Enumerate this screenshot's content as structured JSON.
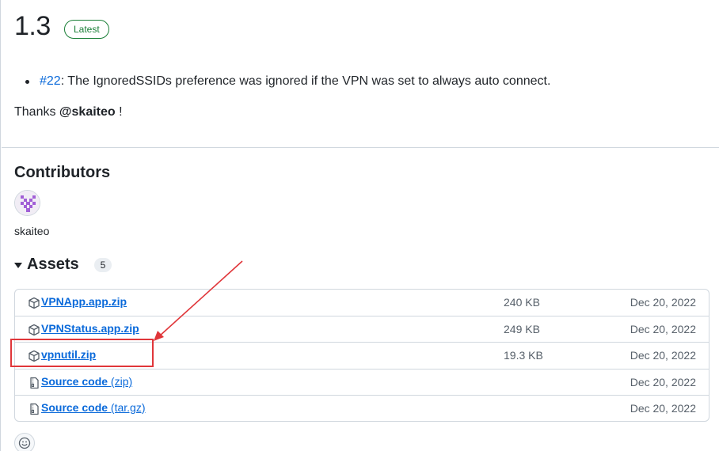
{
  "release": {
    "title": "1.3",
    "badge": "Latest"
  },
  "notes": {
    "issue_link": "#22",
    "issue_text": ": The IgnoredSSIDs preference was ignored if the VPN was set to always auto connect.",
    "thanks_prefix": "Thanks ",
    "thanks_user": "@skaiteo",
    "thanks_suffix": " !"
  },
  "contributors": {
    "heading": "Contributors",
    "users": [
      {
        "name": "skaiteo",
        "avatar_icon": "identicon"
      }
    ]
  },
  "assets": {
    "heading": "Assets",
    "count": "5",
    "items": [
      {
        "name": "VPNApp.app.zip",
        "ext": "",
        "size": "240 KB",
        "date": "Dec 20, 2022",
        "icon": "package-icon"
      },
      {
        "name": "VPNStatus.app.zip",
        "ext": "",
        "size": "249 KB",
        "date": "Dec 20, 2022",
        "icon": "package-icon"
      },
      {
        "name": "vpnutil.zip",
        "ext": "",
        "size": "19.3 KB",
        "date": "Dec 20, 2022",
        "icon": "package-icon"
      },
      {
        "name": "Source code",
        "ext": " (zip)",
        "size": "",
        "date": "Dec 20, 2022",
        "icon": "file-zip-icon"
      },
      {
        "name": "Source code",
        "ext": " (tar.gz)",
        "size": "",
        "date": "Dec 20, 2022",
        "icon": "file-zip-icon"
      }
    ]
  },
  "annotation": {
    "highlight_color": "#e0363a",
    "target": "vpnutil.zip"
  },
  "colors": {
    "link": "#0969da",
    "latest_badge": "#1a7f37",
    "border": "#d0d7de"
  }
}
